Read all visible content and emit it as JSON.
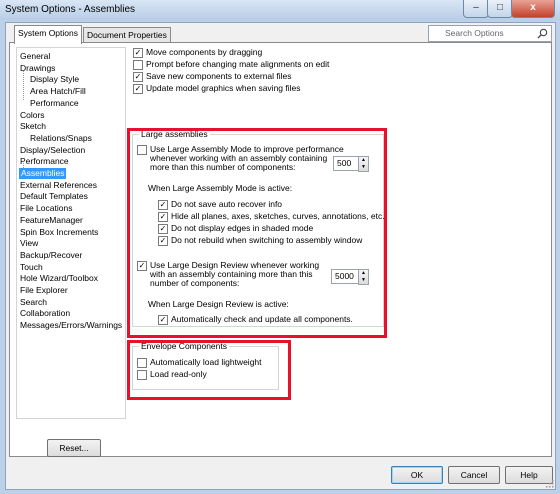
{
  "window": {
    "title": "System Options - Assemblies",
    "minimize": "–",
    "maximize": "□",
    "close": "x"
  },
  "tabs": [
    {
      "label": "System Options"
    },
    {
      "label": "Document Properties"
    }
  ],
  "search": {
    "placeholder": "Search Options"
  },
  "tree": {
    "items": [
      "General",
      "Drawings",
      "Display Style",
      "Area Hatch/Fill",
      "Performance",
      "Colors",
      "Sketch",
      "Relations/Snaps",
      "Display/Selection",
      "Performance",
      "Assemblies",
      "External References",
      "Default Templates",
      "File Locations",
      "FeatureManager",
      "Spin Box Increments",
      "View",
      "Backup/Recover",
      "Touch",
      "Hole Wizard/Toolbox",
      "File Explorer",
      "Search",
      "Collaboration",
      "Messages/Errors/Warnings"
    ],
    "selected": "Assemblies"
  },
  "general_options": [
    {
      "label": "Move components by dragging",
      "checked": true
    },
    {
      "label": "Prompt before changing mate alignments on edit",
      "checked": false
    },
    {
      "label": "Save new components to external files",
      "checked": true
    },
    {
      "label": "Update model graphics when saving files",
      "checked": true
    }
  ],
  "large_assemblies": {
    "title": "Large assemblies",
    "lam_line1": "Use Large Assembly Mode to improve performance",
    "lam_line2": "whenever working with an assembly containing",
    "lam_line3": "more than this number of components:",
    "lam_checked": false,
    "lam_value": "500",
    "lam_active_label": "When Large Assembly Mode is active:",
    "lam_options": [
      {
        "label": "Do not save auto recover info",
        "checked": true
      },
      {
        "label": "Hide all planes, axes, sketches, curves, annotations, etc.",
        "checked": true
      },
      {
        "label": "Do not display edges in shaded mode",
        "checked": true
      },
      {
        "label": "Do not rebuild when switching to assembly window",
        "checked": true
      }
    ],
    "ldr_line1": "Use Large Design Review whenever working",
    "ldr_line2": "with an assembly containing more than this",
    "ldr_line3": "number of components:",
    "ldr_checked": true,
    "ldr_value": "5000",
    "ldr_active_label": "When Large Design Review is active:",
    "ldr_options": [
      {
        "label": "Automatically check and update all components.",
        "checked": true
      }
    ]
  },
  "envelope": {
    "title": "Envelope Components",
    "options": [
      {
        "label": "Automatically load lightweight",
        "checked": false
      },
      {
        "label": "Load read-only",
        "checked": false
      }
    ]
  },
  "buttons": {
    "reset": "Reset...",
    "ok": "OK",
    "cancel": "Cancel",
    "help": "Help"
  },
  "colors": {
    "highlight": "#3399ff",
    "annotation_red": "#e8102a"
  }
}
